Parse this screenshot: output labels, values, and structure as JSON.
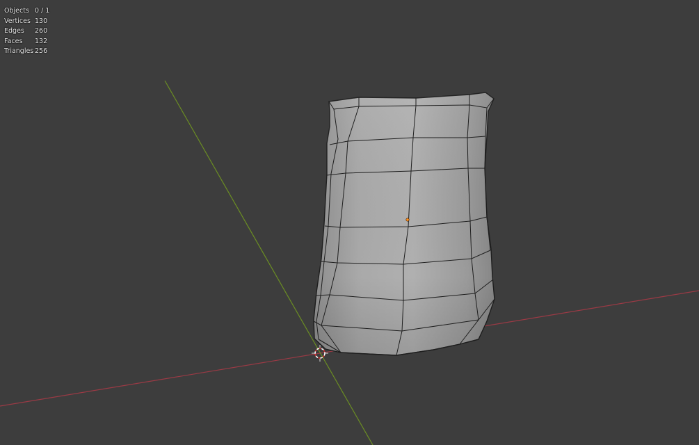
{
  "stats": [
    {
      "label": "Objects",
      "value": "0 / 1"
    },
    {
      "label": "Vertices",
      "value": "130"
    },
    {
      "label": "Edges",
      "value": "260"
    },
    {
      "label": "Faces",
      "value": "132"
    },
    {
      "label": "Triangles",
      "value": "256"
    }
  ],
  "colors": {
    "background": "#3d3d3d",
    "x_axis": "#9b3a45",
    "y_axis": "#6b8e23",
    "mesh_fill": "#a4a4a4",
    "wire": "#1e1e1e",
    "origin": "#ff8c1a"
  },
  "icons": {
    "cursor": "3d-cursor-icon",
    "origin": "object-origin-icon"
  }
}
